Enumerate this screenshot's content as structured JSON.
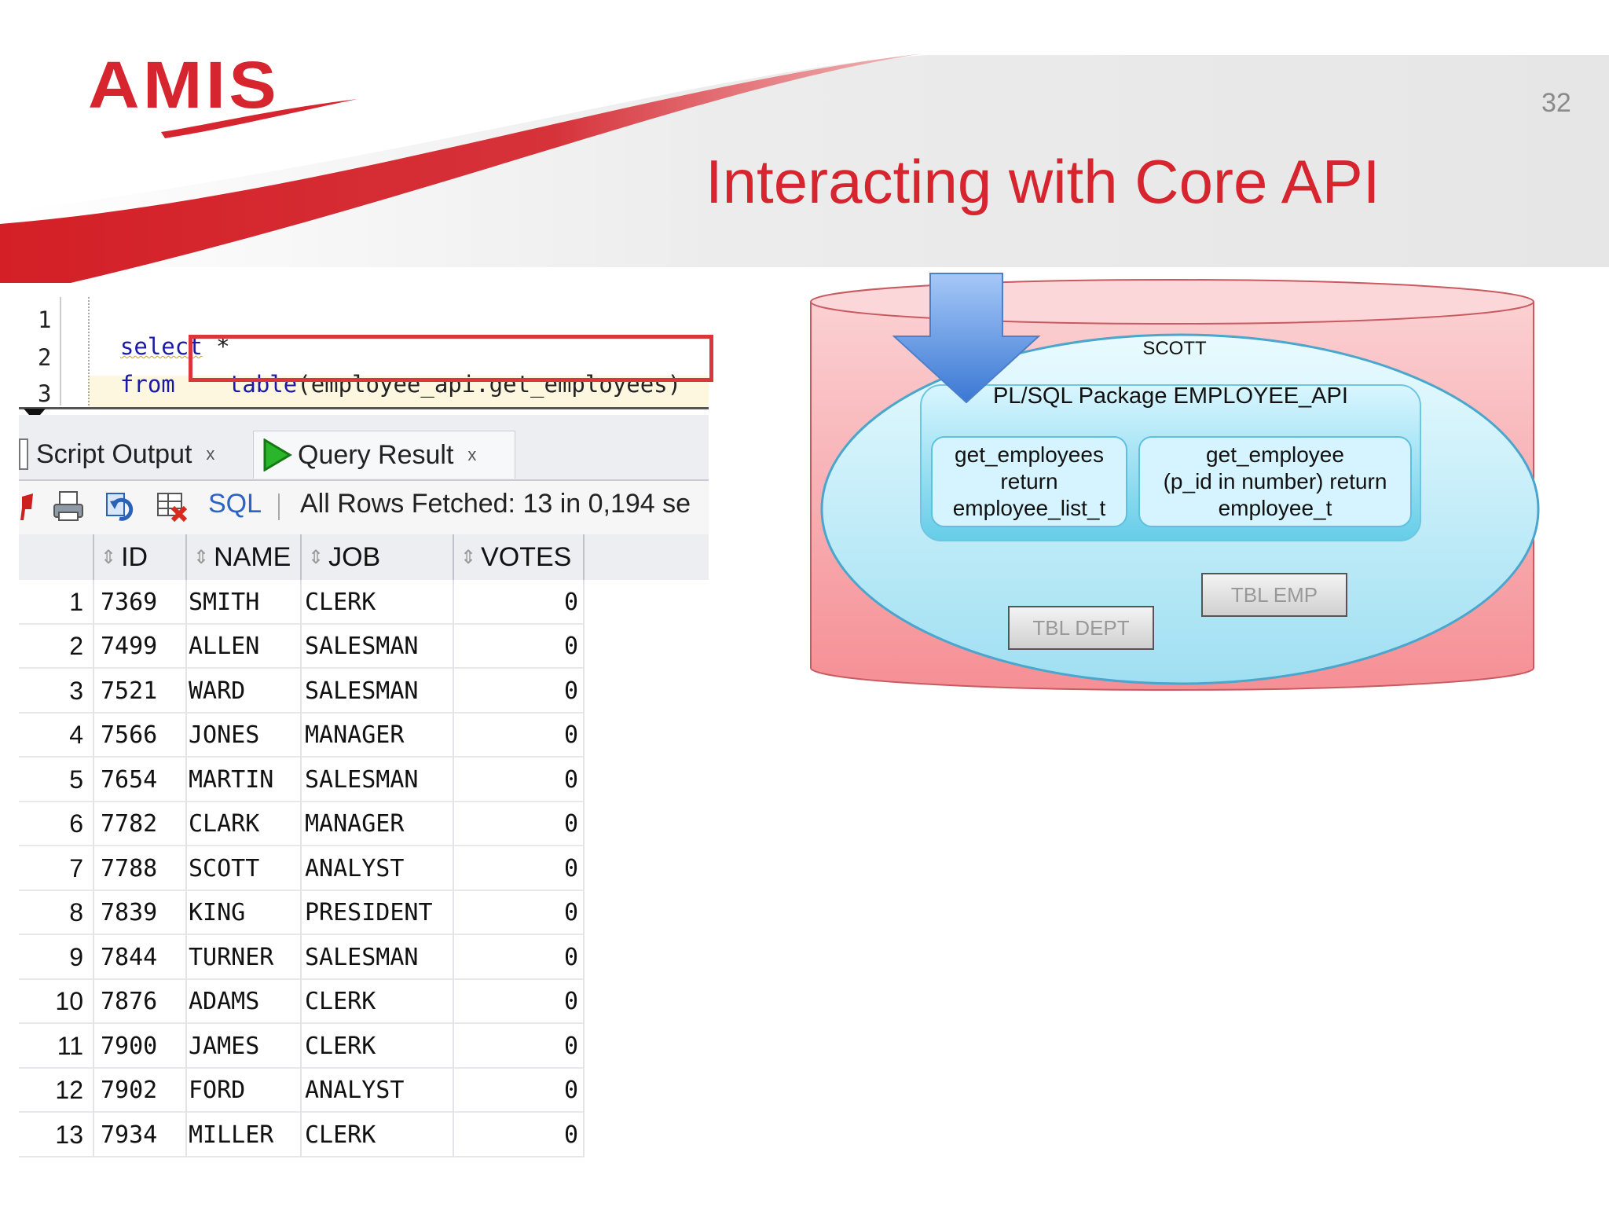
{
  "slide": {
    "logo": "AMIS",
    "page_number": "32",
    "title": "Interacting with Core API"
  },
  "editor": {
    "line_numbers": [
      "1",
      "2",
      "3"
    ],
    "line1_keyword": "select",
    "line1_rest": " *",
    "line2_keyword": "from",
    "line2_func": "table",
    "line2_rest": "(employee_api.get_employees)"
  },
  "tabs": [
    {
      "label": "Script Output",
      "close": "x"
    },
    {
      "label": "Query Result",
      "close": "x"
    }
  ],
  "toolbar": {
    "sql_label": "SQL",
    "status": "All Rows Fetched: 13 in 0,194 se"
  },
  "grid": {
    "columns": [
      "ID",
      "NAME",
      "JOB",
      "VOTES"
    ],
    "rows": [
      [
        "1",
        "7369",
        "SMITH",
        "CLERK",
        "0"
      ],
      [
        "2",
        "7499",
        "ALLEN",
        "SALESMAN",
        "0"
      ],
      [
        "3",
        "7521",
        "WARD",
        "SALESMAN",
        "0"
      ],
      [
        "4",
        "7566",
        "JONES",
        "MANAGER",
        "0"
      ],
      [
        "5",
        "7654",
        "MARTIN",
        "SALESMAN",
        "0"
      ],
      [
        "6",
        "7782",
        "CLARK",
        "MANAGER",
        "0"
      ],
      [
        "7",
        "7788",
        "SCOTT",
        "ANALYST",
        "0"
      ],
      [
        "8",
        "7839",
        "KING",
        "PRESIDENT",
        "0"
      ],
      [
        "9",
        "7844",
        "TURNER",
        "SALESMAN",
        "0"
      ],
      [
        "10",
        "7876",
        "ADAMS",
        "CLERK",
        "0"
      ],
      [
        "11",
        "7900",
        "JAMES",
        "CLERK",
        "0"
      ],
      [
        "12",
        "7902",
        "FORD",
        "ANALYST",
        "0"
      ],
      [
        "13",
        "7934",
        "MILLER",
        "CLERK",
        "0"
      ]
    ]
  },
  "diagram": {
    "schema": "SCOTT",
    "package": "PL/SQL Package EMPLOYEE_API",
    "func1": [
      "get_employees",
      "return",
      "employee_list_t"
    ],
    "func2": [
      "get_employee",
      "(p_id in number) return",
      "employee_t"
    ],
    "table_emp": "TBL EMP",
    "table_dept": "TBL DEPT"
  },
  "colors": {
    "brand_red": "#d6252f",
    "highlight_box": "#d9363e",
    "cylinder": "#f8a8ab",
    "ellipse": "#aee6f6",
    "arrow": "#5b8fdd"
  }
}
